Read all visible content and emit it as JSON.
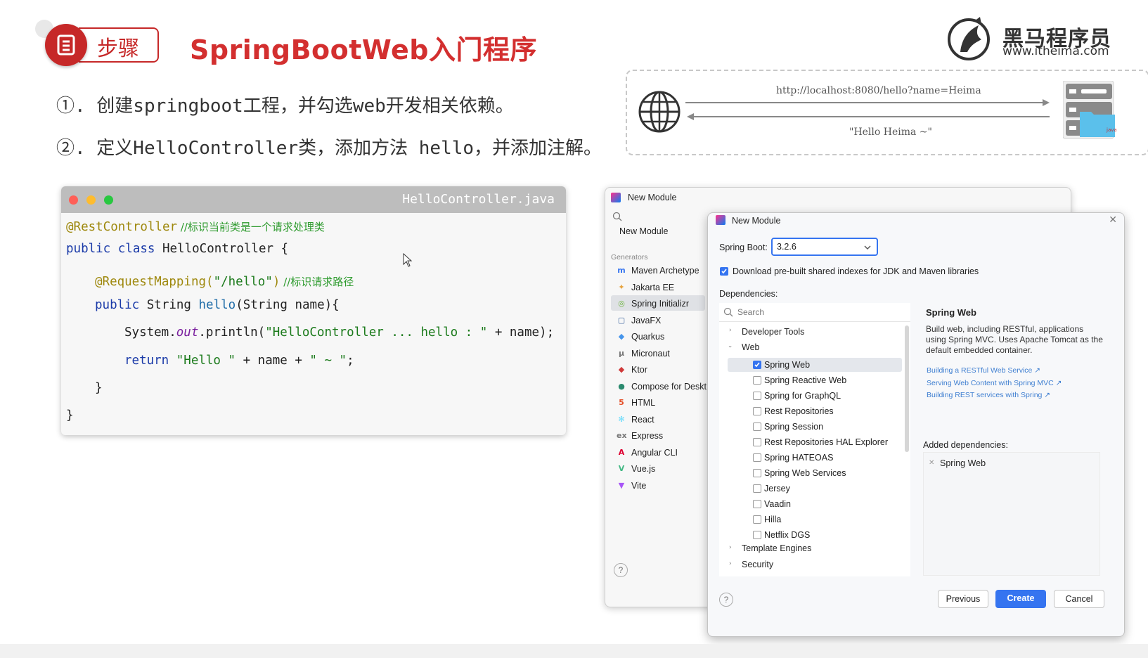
{
  "header": {
    "badge_label": "步骤",
    "title": "SpringBootWeb入门程序",
    "logo_cn": "黑马程序员",
    "logo_url": "www.itheima.com"
  },
  "steps": [
    "①. 创建springboot工程，并勾选web开发相关依赖。",
    "②. 定义HelloController类，添加方法 hello，并添加注解。"
  ],
  "diagram": {
    "request_url": "http://localhost:8080/hello?name=Heima",
    "response_text": "\"Hello Heima ~\""
  },
  "code_window": {
    "filename": "HelloController.java",
    "lines": {
      "l1_annotation": "@RestController",
      "l1_comment": " //标识当前类是一个请求处理类",
      "l2_kw": "public class",
      "l2_rest": " HelloController {",
      "l3_annotation": "@RequestMapping(",
      "l3_str": "\"/hello\"",
      "l3_close": ")",
      "l3_comment": " //标识请求路径",
      "l4_kw": "public",
      "l4_type": " String ",
      "l4_fn": "hello",
      "l4_rest": "(String name){",
      "l5_sys": "System.",
      "l5_out": "out",
      "l5_println": ".println(",
      "l5_str": "\"HelloController ... hello : \"",
      "l5_rest": " + name);",
      "l6_kw": "return",
      "l6_str1": " \"Hello \"",
      "l6_mid": " + name + ",
      "l6_str2": "\" ~ \"",
      "l6_end": ";",
      "l7": "}",
      "l8": "}"
    }
  },
  "ide_back": {
    "title": "New Module",
    "selected_top": "New Module",
    "generators_label": "Generators",
    "generators": [
      {
        "label": "Maven Archetype",
        "icon": "m",
        "color": "#3574f0"
      },
      {
        "label": "Jakarta EE",
        "icon": "✦",
        "color": "#e6a23c"
      },
      {
        "label": "Spring Initializr",
        "icon": "◎",
        "color": "#6db33f"
      },
      {
        "label": "JavaFX",
        "icon": "▢",
        "color": "#4a6fa5"
      },
      {
        "label": "Quarkus",
        "icon": "◆",
        "color": "#4695eb"
      },
      {
        "label": "Micronaut",
        "icon": "μ",
        "color": "#777777"
      },
      {
        "label": "Ktor",
        "icon": "◆",
        "color": "#d03a3a"
      },
      {
        "label": "Compose for Deskt",
        "icon": "●",
        "color": "#2b8a6e"
      },
      {
        "label": "HTML",
        "icon": "5",
        "color": "#e44d26"
      },
      {
        "label": "React",
        "icon": "✻",
        "color": "#61dafb"
      },
      {
        "label": "Express",
        "icon": "ex",
        "color": "#777777"
      },
      {
        "label": "Angular CLI",
        "icon": "A",
        "color": "#dd0031"
      },
      {
        "label": "Vue.js",
        "icon": "V",
        "color": "#41b883"
      },
      {
        "label": "Vite",
        "icon": "▼",
        "color": "#a855f7"
      }
    ],
    "help_symbol": "?"
  },
  "ide_front": {
    "title": "New Module",
    "spring_boot_label": "Spring Boot:",
    "spring_boot_version": "3.2.6",
    "download_label": "Download pre-built shared indexes for JDK and Maven libraries",
    "dependencies_label": "Dependencies:",
    "search_placeholder": "Search",
    "tree_groups": {
      "dev_tools": "Developer Tools",
      "web": "Web",
      "template_engines": "Template Engines",
      "security": "Security"
    },
    "web_items": [
      {
        "label": "Spring Web",
        "checked": true
      },
      {
        "label": "Spring Reactive Web",
        "checked": false
      },
      {
        "label": "Spring for GraphQL",
        "checked": false
      },
      {
        "label": "Rest Repositories",
        "checked": false
      },
      {
        "label": "Spring Session",
        "checked": false
      },
      {
        "label": "Rest Repositories HAL Explorer",
        "checked": false
      },
      {
        "label": "Spring HATEOAS",
        "checked": false
      },
      {
        "label": "Spring Web Services",
        "checked": false
      },
      {
        "label": "Jersey",
        "checked": false
      },
      {
        "label": "Vaadin",
        "checked": false
      },
      {
        "label": "Hilla",
        "checked": false
      },
      {
        "label": "Netflix DGS",
        "checked": false
      }
    ],
    "detail": {
      "title": "Spring Web",
      "description": "Build web, including RESTful, applications using Spring MVC. Uses Apache Tomcat as the default embedded container.",
      "links": [
        "Building a RESTful Web Service ↗",
        "Serving Web Content with Spring MVC ↗",
        "Building REST services with Spring ↗"
      ]
    },
    "added_label": "Added dependencies:",
    "added_items": [
      "Spring Web"
    ],
    "buttons": {
      "previous": "Previous",
      "create": "Create",
      "cancel": "Cancel"
    },
    "help_symbol": "?",
    "close_symbol": "✕"
  },
  "colors": {
    "accent_red": "#d32f2f",
    "ide_blue": "#3574f0"
  }
}
